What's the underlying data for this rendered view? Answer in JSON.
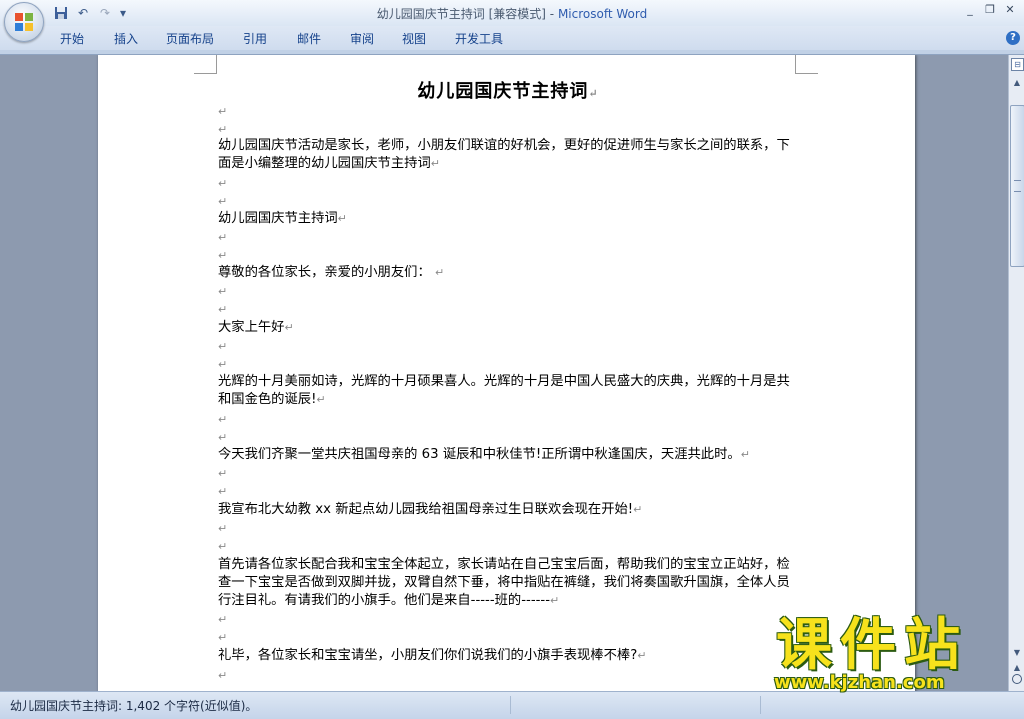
{
  "window": {
    "title": "幼儿园国庆节主持词 [兼容模式]",
    "separator": " - ",
    "app_name": "Microsoft Word",
    "controls": [
      "_",
      "❐",
      "✕"
    ]
  },
  "quick_access": {
    "save_icon": "save-icon",
    "undo_icon": "undo-icon",
    "redo_icon": "redo-icon",
    "customize_icon": "customize-icon"
  },
  "ribbon": {
    "tabs": [
      "开始",
      "插入",
      "页面布局",
      "引用",
      "邮件",
      "审阅",
      "视图",
      "开发工具"
    ],
    "help_icon": "?"
  },
  "document": {
    "heading": "幼儿园国庆节主持词",
    "paragraph_mark": "↵",
    "paragraphs": [
      "幼儿园国庆节活动是家长，老师，小朋友们联谊的好机会，更好的促进师生与家长之间的联系，下面是小编整理的幼儿园国庆节主持词",
      "幼儿园国庆节主持词",
      "尊敬的各位家长，亲爱的小朋友们：",
      "大家上午好",
      "光辉的十月美丽如诗，光辉的十月硕果喜人。光辉的十月是中国人民盛大的庆典，光辉的十月是共和国金色的诞辰!",
      "今天我们齐聚一堂共庆祖国母亲的 63 诞辰和中秋佳节!正所谓中秋逢国庆，天涯共此时。",
      "我宣布北大幼教 xx 新起点幼儿园我给祖国母亲过生日联欢会现在开始!",
      "首先请各位家长配合我和宝宝全体起立，家长请站在自己宝宝后面，帮助我们的宝宝立正站好，检查一下宝宝是否做到双脚并拢，双臂自然下垂，将中指贴在裤缝，我们将奏国歌升国旗，全体人员行注目礼。有请我们的小旗手。他们是来自-----班的------",
      "礼毕，各位家长和宝宝请坐，小朋友们你们说我们的小旗手表现棒不棒?"
    ]
  },
  "status_bar": {
    "text": "幼儿园国庆节主持词: 1,402 个字符(近似值)。"
  },
  "watermark": {
    "chinese": "课件站",
    "url": "www.kjzhan.com"
  }
}
